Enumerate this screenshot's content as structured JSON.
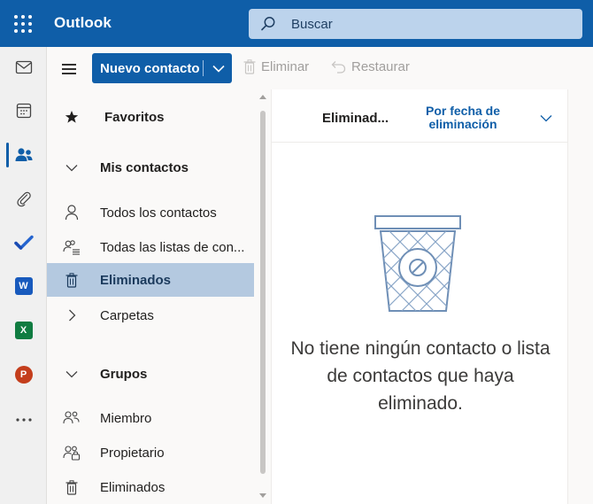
{
  "app": {
    "title": "Outlook"
  },
  "search": {
    "placeholder": "Buscar"
  },
  "rail": {
    "items": [
      {
        "icon": "mail-icon"
      },
      {
        "icon": "calendar-icon"
      },
      {
        "icon": "people-icon",
        "active": true
      },
      {
        "icon": "attachment-icon"
      },
      {
        "icon": "todo-icon"
      },
      {
        "icon": "word-icon",
        "letter": "W",
        "color": "#185abd"
      },
      {
        "icon": "excel-icon",
        "letter": "X",
        "color": "#107c41"
      },
      {
        "icon": "powerpoint-icon",
        "letter": "P",
        "color": "#c43e1c"
      },
      {
        "icon": "more-apps-icon"
      }
    ]
  },
  "toolbar": {
    "new_label": "Nuevo contacto",
    "delete_label": "Eliminar",
    "restore_label": "Restaurar"
  },
  "folders": {
    "favorites": "Favoritos",
    "my_contacts": "Mis contactos",
    "all_contacts": "Todos los contactos",
    "all_lists": "Todas las listas de con...",
    "deleted": "Eliminados",
    "folders": "Carpetas",
    "groups": "Grupos",
    "member": "Miembro",
    "owner": "Propietario",
    "groups_deleted": "Eliminados"
  },
  "list": {
    "title": "Eliminad...",
    "sort_label": "Por fecha de eliminación",
    "empty_message": "No tiene ningún contacto o lista de contactos que haya eliminado."
  },
  "colors": {
    "brand": "#0f5ea8",
    "search_bg": "#bcd3ec",
    "selected_bg": "#b4c9e0"
  }
}
